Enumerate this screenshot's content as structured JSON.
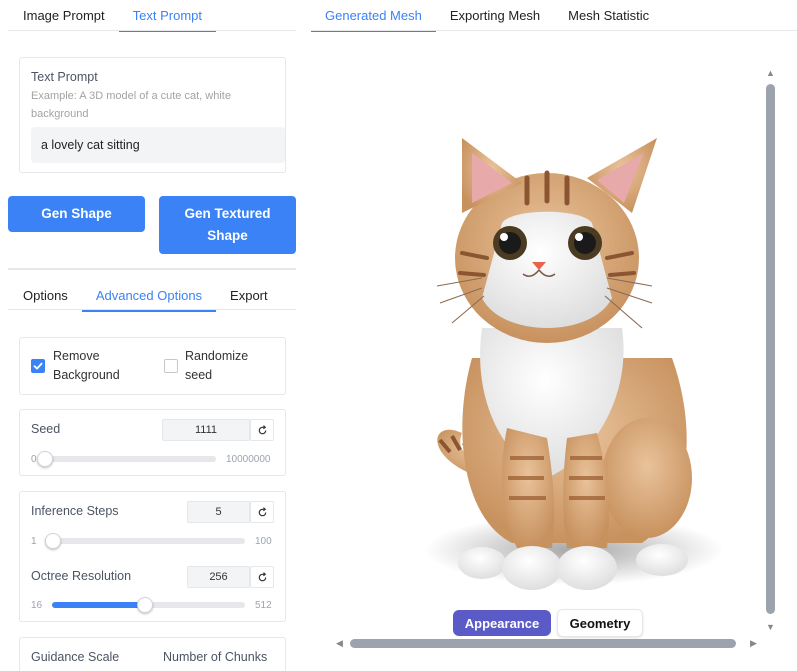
{
  "left_tabs": [
    "Image Prompt",
    "Text Prompt"
  ],
  "left_tab_active": "Text Prompt",
  "text_prompt": {
    "label": "Text Prompt",
    "hint": "Example: A 3D model of a cute cat, white background",
    "value": "a lovely cat sitting"
  },
  "buttons": {
    "gen_shape": "Gen Shape",
    "gen_textured_line1": "Gen Textured",
    "gen_textured_line2": "Shape"
  },
  "option_tabs": [
    "Options",
    "Advanced Options",
    "Export"
  ],
  "option_tab_active": "Advanced Options",
  "checkboxes": {
    "remove_bg_line1": "Remove",
    "remove_bg_line2": "Background",
    "remove_bg_checked": true,
    "randomize_line1": "Randomize",
    "randomize_line2": "seed",
    "randomize_checked": false
  },
  "seed": {
    "label": "Seed",
    "value": "1111",
    "min": "0",
    "max": "10000000",
    "fraction": 0.0
  },
  "inference_steps": {
    "label": "Inference Steps",
    "value": "5",
    "min": "1",
    "max": "100",
    "fraction": 0.04
  },
  "octree_resolution": {
    "label": "Octree Resolution",
    "value": "256",
    "min": "16",
    "max": "512",
    "fraction": 0.484
  },
  "bottom_labels": {
    "guidance": "Guidance Scale",
    "chunks": "Number of Chunks"
  },
  "right_tabs": [
    "Generated Mesh",
    "Exporting Mesh",
    "Mesh Statistic"
  ],
  "right_tab_active": "Generated Mesh",
  "view_modes": {
    "appearance": "Appearance",
    "geometry": "Geometry",
    "active": "Appearance"
  },
  "colors": {
    "accent": "#3b82f6",
    "mode_active": "#5b5bc8"
  },
  "icons": {
    "reset": "reset-icon",
    "check": "check-icon"
  }
}
